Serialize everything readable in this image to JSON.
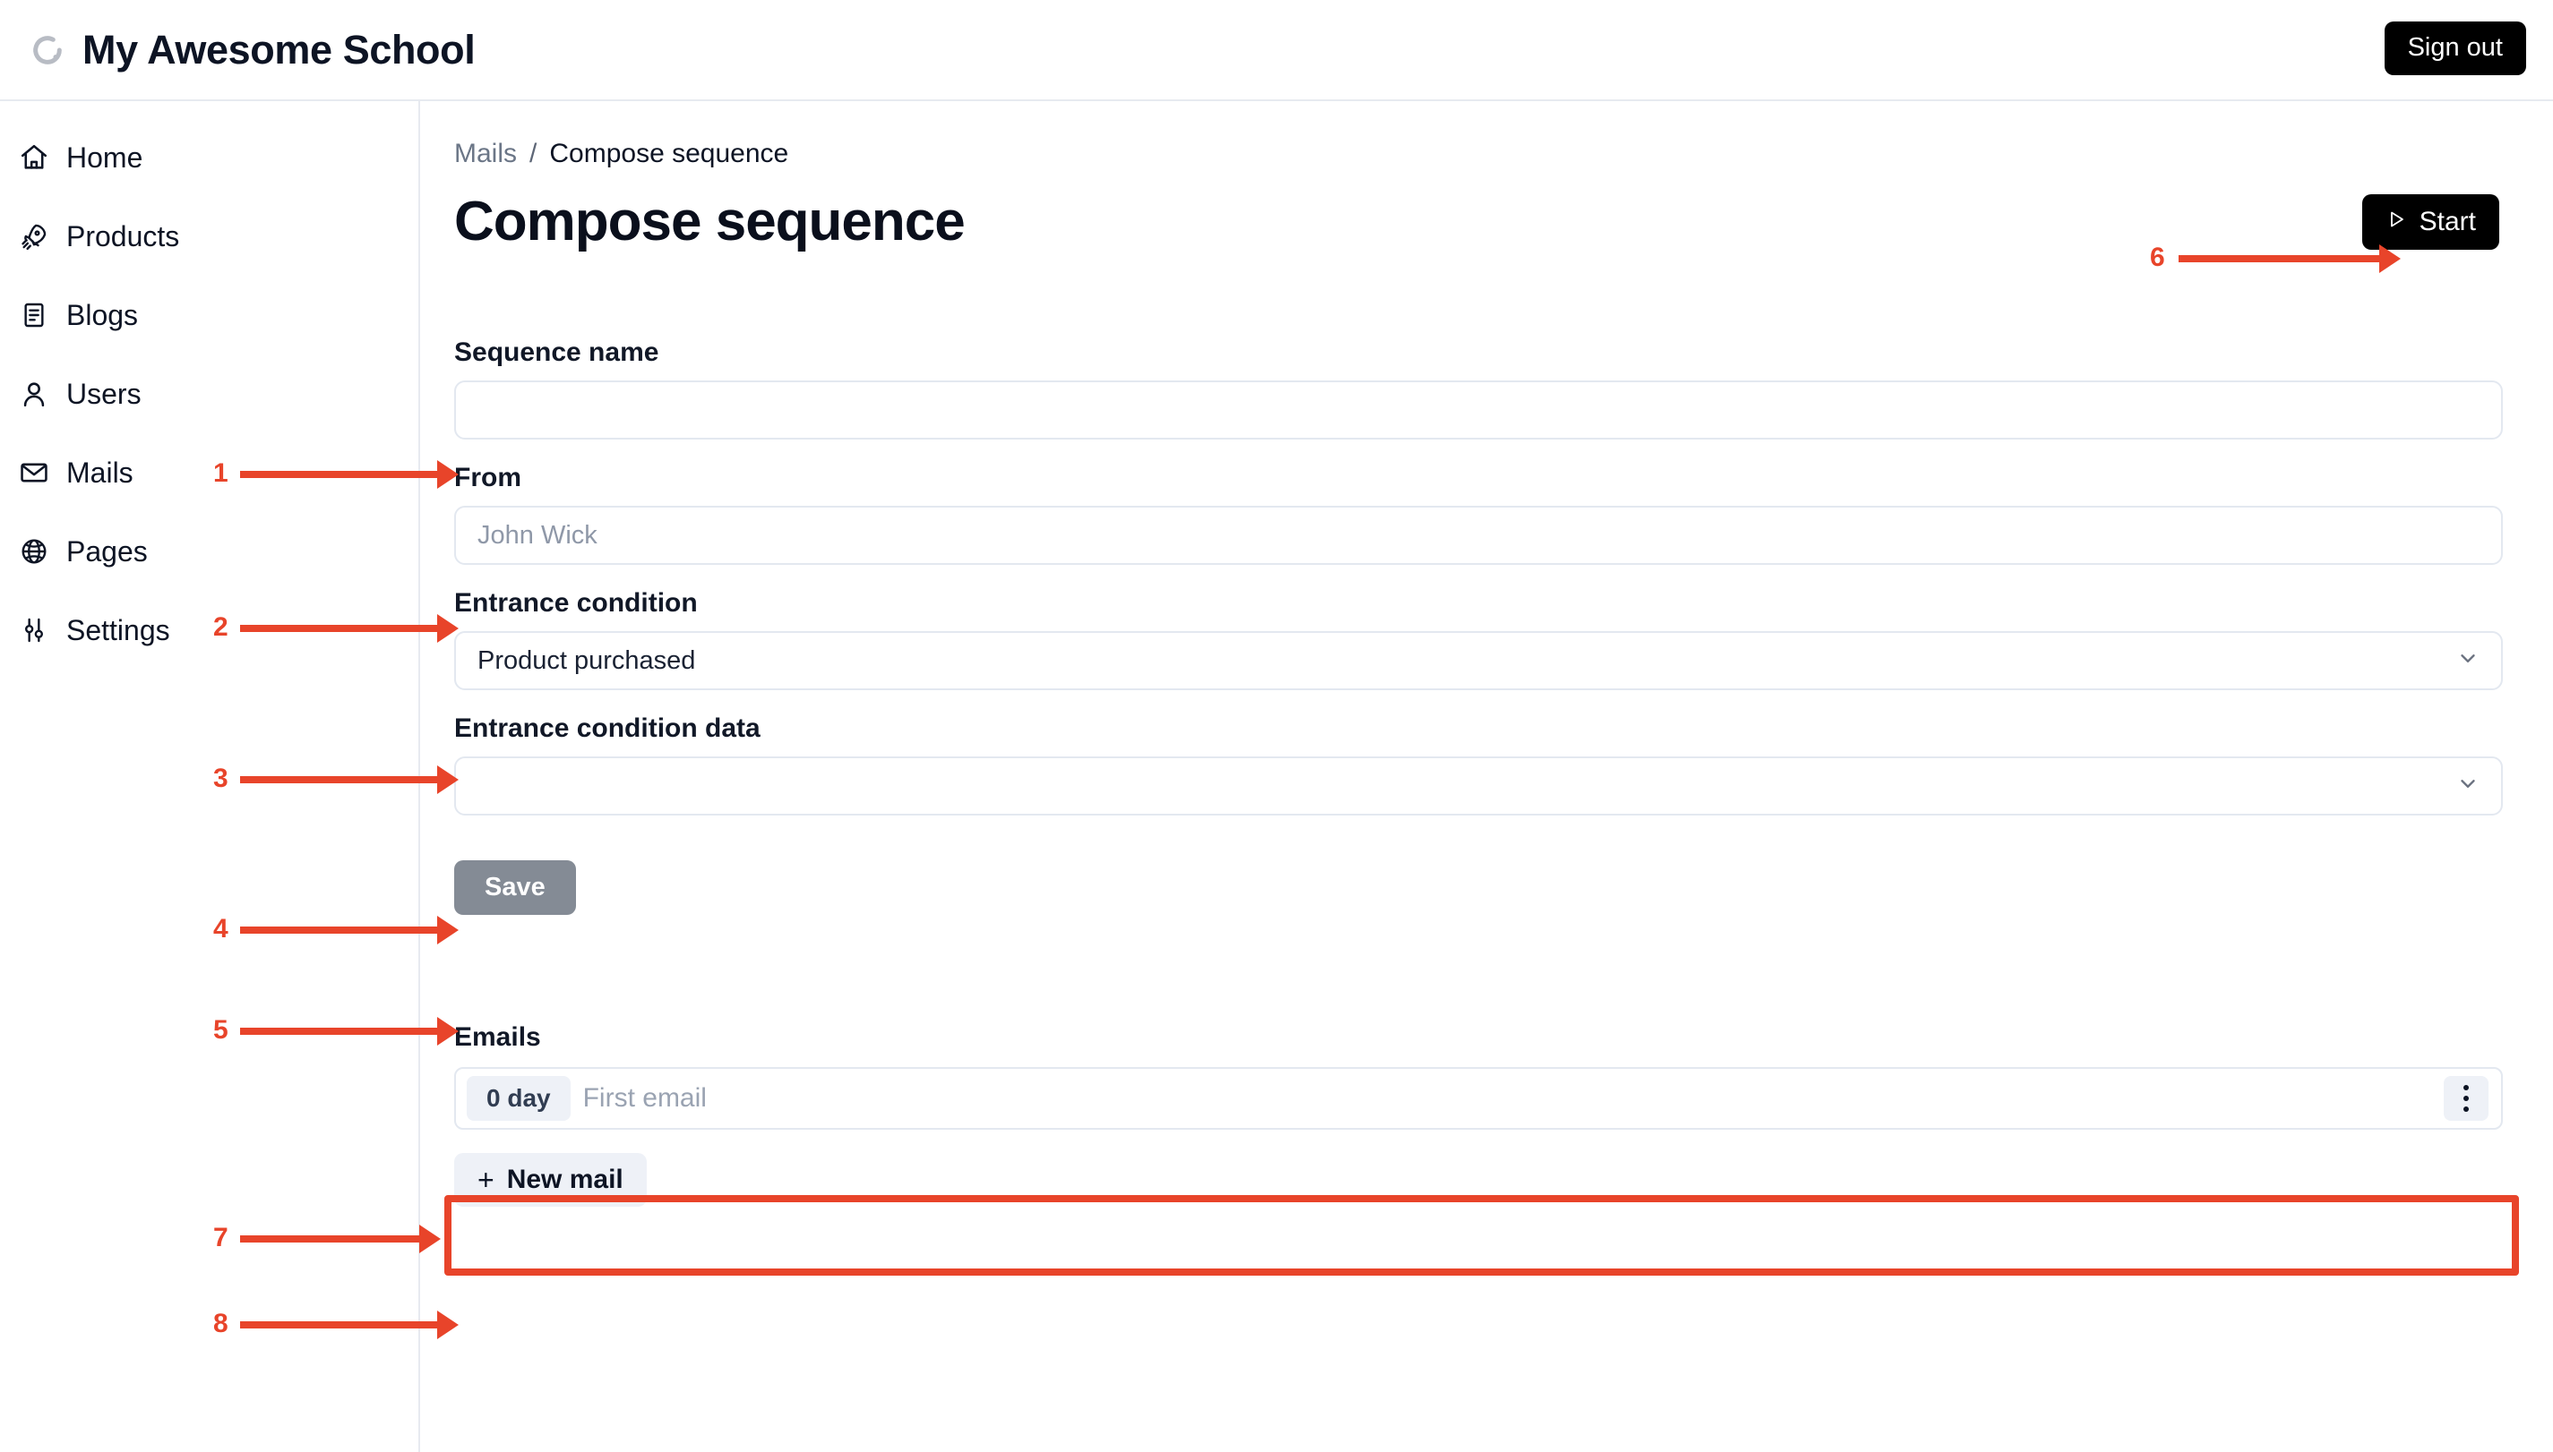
{
  "header": {
    "logo_icon": "spinner-c-icon",
    "site_title": "My Awesome School",
    "sign_out_label": "Sign out"
  },
  "sidebar": {
    "items": [
      {
        "label": "Home",
        "icon": "home-icon"
      },
      {
        "label": "Products",
        "icon": "rocket-icon"
      },
      {
        "label": "Blogs",
        "icon": "document-icon"
      },
      {
        "label": "Users",
        "icon": "user-icon"
      },
      {
        "label": "Mails",
        "icon": "envelope-icon"
      },
      {
        "label": "Pages",
        "icon": "globe-icon"
      },
      {
        "label": "Settings",
        "icon": "sliders-icon"
      }
    ]
  },
  "main": {
    "breadcrumb": {
      "parent": "Mails",
      "separator": "/",
      "current": "Compose sequence"
    },
    "page_title": "Compose sequence",
    "start_button": {
      "label": "Start",
      "icon": "play-triangle-icon"
    },
    "form": {
      "sequence_name": {
        "label": "Sequence name",
        "value": "",
        "placeholder": ""
      },
      "from": {
        "label": "From",
        "value": "",
        "placeholder": "John Wick"
      },
      "entrance_condition": {
        "label": "Entrance condition",
        "value": "Product purchased"
      },
      "entrance_condition_data": {
        "label": "Entrance condition data",
        "value": ""
      },
      "save_button": "Save"
    },
    "emails": {
      "heading": "Emails",
      "rows": [
        {
          "day": "0 day",
          "subject": "",
          "subject_placeholder": "First email",
          "menu_icon": "kebab-menu-icon"
        }
      ],
      "new_mail_button": {
        "plus": "+",
        "label": "New mail"
      }
    }
  },
  "annotations": {
    "color": "#e8442a",
    "markers": [
      "1",
      "2",
      "3",
      "4",
      "5",
      "6",
      "7",
      "8"
    ]
  }
}
